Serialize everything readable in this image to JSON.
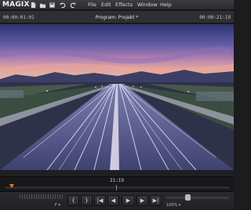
{
  "app": {
    "logo": "MAGIX"
  },
  "toolbar": {
    "icons": [
      "new-file-icon",
      "open-folder-icon",
      "save-icon",
      "undo-icon",
      "redo-icon"
    ]
  },
  "menu": {
    "items": [
      {
        "label": "File"
      },
      {
        "label": "Edit"
      },
      {
        "label": "Effects"
      },
      {
        "label": "Window"
      },
      {
        "label": "Help"
      }
    ]
  },
  "program": {
    "timecode_left": "00:00:01:01",
    "title": "Program: Projekt *",
    "timecode_right": "00:00:21:19"
  },
  "preview": {
    "scene": "highway-dusk-light-trails",
    "sky_colors": [
      "#3a3f8a",
      "#7a6cb8",
      "#c98aa8",
      "#e3a99a"
    ],
    "road_color": "#5b5f8a"
  },
  "timeline": {
    "position_label": "21:19",
    "marker_color": "#e8781a"
  },
  "controls": {
    "buttons": [
      {
        "label": "{",
        "name": "mark-in-button"
      },
      {
        "label": "}",
        "name": "mark-out-button"
      },
      {
        "label": "|◀",
        "name": "prev-marker-button"
      },
      {
        "label": "◀",
        "name": "step-back-button"
      },
      {
        "label": "▶",
        "name": "play-button"
      },
      {
        "label": "▶",
        "name": "step-forward-button"
      },
      {
        "label": "▶|",
        "name": "next-marker-button"
      }
    ],
    "speed_label": "F ▾",
    "zoom_label": "100% ▾"
  }
}
